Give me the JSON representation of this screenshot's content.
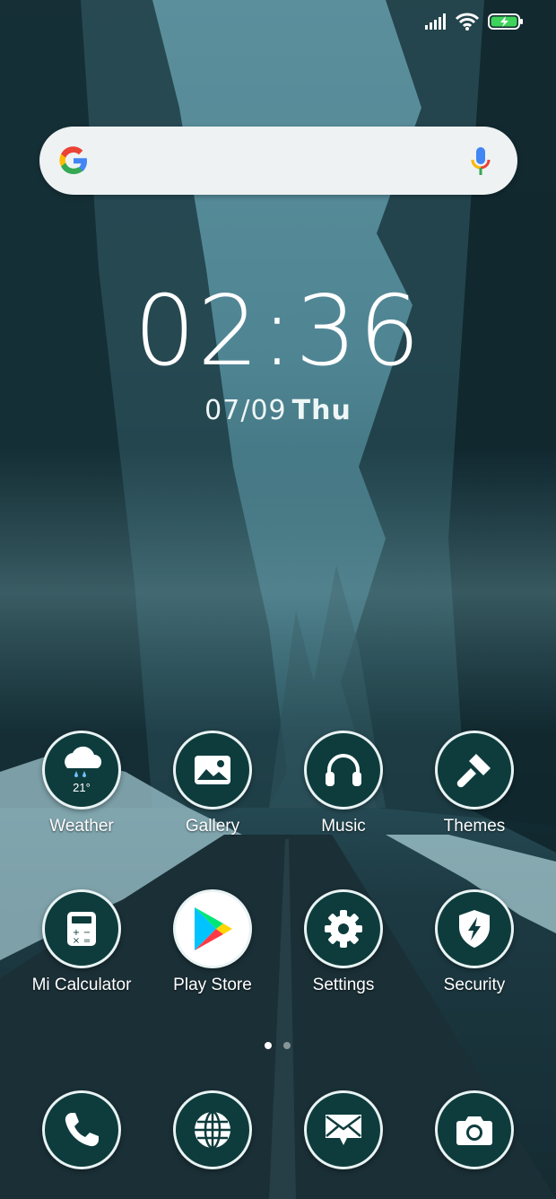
{
  "clock": {
    "time": "02:36",
    "date": "07/09",
    "day": "Thu"
  },
  "status": {
    "signal_icon": "signal-icon",
    "wifi_icon": "wifi-icon",
    "battery_icon": "battery-charging-icon"
  },
  "search": {
    "logo": "google-logo",
    "mic_icon": "microphone-icon"
  },
  "apps_row1": [
    {
      "label": "Weather",
      "icon": "weather-cloud-rain-icon",
      "temp": "21°"
    },
    {
      "label": "Gallery",
      "icon": "gallery-image-icon"
    },
    {
      "label": "Music",
      "icon": "headphones-icon"
    },
    {
      "label": "Themes",
      "icon": "paintbrush-icon"
    }
  ],
  "apps_row2": [
    {
      "label": "Mi Calculator",
      "icon": "calculator-icon"
    },
    {
      "label": "Play Store",
      "icon": "play-store-icon"
    },
    {
      "label": "Settings",
      "icon": "gear-icon"
    },
    {
      "label": "Security",
      "icon": "shield-bolt-icon"
    }
  ],
  "dock": [
    {
      "icon": "phone-icon"
    },
    {
      "icon": "browser-globe-icon"
    },
    {
      "icon": "messages-envelope-icon"
    },
    {
      "icon": "camera-icon"
    }
  ],
  "page_indicator": {
    "pages": 2,
    "current": 1
  },
  "colors": {
    "icon_bg": "#0e3c3d",
    "icon_border": "#e9f3f3"
  }
}
